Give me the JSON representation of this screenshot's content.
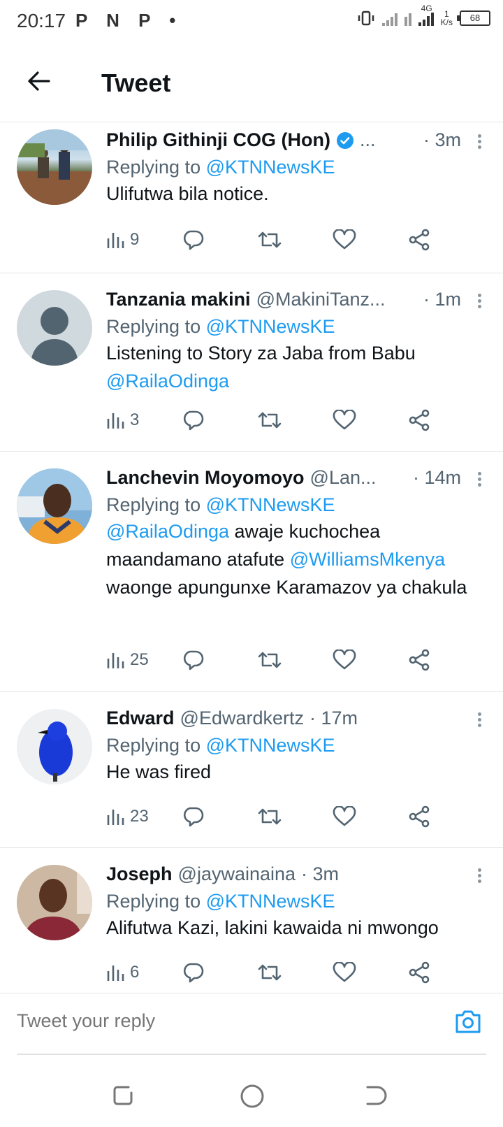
{
  "status_bar": {
    "time": "20:17",
    "left_icons": "P N P •",
    "network": "4G",
    "speed": "1",
    "speed_unit": "K/s",
    "battery": "68"
  },
  "header": {
    "title": "Tweet"
  },
  "tweets": [
    {
      "name": "Philip Githinji COG (Hon)",
      "handle": "...",
      "time": "· 3m",
      "verified": true,
      "replying_prefix": "Replying to",
      "replying_to": "@KTNNewsKE",
      "text": "Ulifutwa bila notice.",
      "views": "9"
    },
    {
      "name": "Tanzania makini",
      "handle": "@MakiniTanz...",
      "time": "· 1m",
      "replying_prefix": "Replying to",
      "replying_to": "@KTNNewsKE",
      "text_line1": "Listening to Story za Jaba from Babu",
      "text_mention": "@RailaOdinga",
      "views": "3"
    },
    {
      "name": "Lanchevin Moyomoyo",
      "handle": "@Lan...",
      "time": "· 14m",
      "replying_prefix": "Replying to",
      "replying_to": "@KTNNewsKE",
      "text_mention1": "@RailaOdinga",
      "text_part1": " awaje kuchochea maandamano atafute ",
      "text_mention2": "@WilliamsMkenya",
      "text_part2": " waonge apungunxe Karamazov ya chakula",
      "views": "25"
    },
    {
      "name": "Edward",
      "handle": "@Edwardkertz",
      "time": "· 17m",
      "replying_prefix": "Replying to",
      "replying_to": "@KTNNewsKE",
      "text": "He was fired",
      "views": "23"
    },
    {
      "name": "Joseph",
      "handle": "@jaywainaina",
      "time": "· 3m",
      "replying_prefix": "Replying to",
      "replying_to": "@KTNNewsKE",
      "text": "Alifutwa Kazi, lakini kawaida ni mwongo",
      "views": "6"
    }
  ],
  "reply_bar": {
    "placeholder": "Tweet your reply"
  },
  "colors": {
    "accent": "#1d9bf0",
    "secondary_text": "#536471",
    "primary_text": "#0f1419"
  }
}
